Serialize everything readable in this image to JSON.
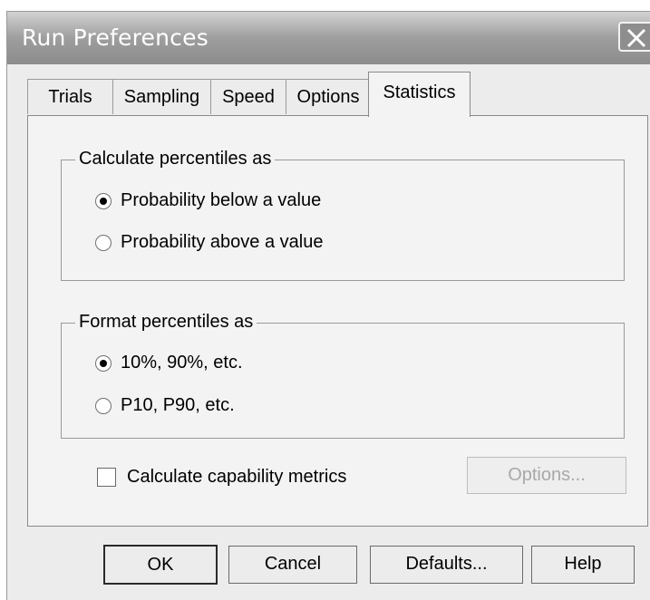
{
  "window": {
    "title": "Run Preferences"
  },
  "tabs": [
    {
      "label": "Trials"
    },
    {
      "label": "Sampling"
    },
    {
      "label": "Speed"
    },
    {
      "label": "Options"
    },
    {
      "label": "Statistics",
      "selected": true
    }
  ],
  "percentiles_group": {
    "title": "Calculate percentiles as",
    "options": [
      {
        "label": "Probability below a value",
        "selected": true
      },
      {
        "label": "Probability above a value",
        "selected": false
      }
    ]
  },
  "format_group": {
    "title": "Format percentiles as",
    "options": [
      {
        "label": "10%, 90%, etc.",
        "selected": true
      },
      {
        "label": "P10, P90, etc.",
        "selected": false
      }
    ]
  },
  "capability": {
    "label": "Calculate capability metrics",
    "checked": false
  },
  "options_button": {
    "label": "Options...",
    "enabled": false
  },
  "buttons": {
    "ok": "OK",
    "cancel": "Cancel",
    "defaults": "Defaults...",
    "help": "Help"
  },
  "icons": {
    "close": "close-icon"
  }
}
